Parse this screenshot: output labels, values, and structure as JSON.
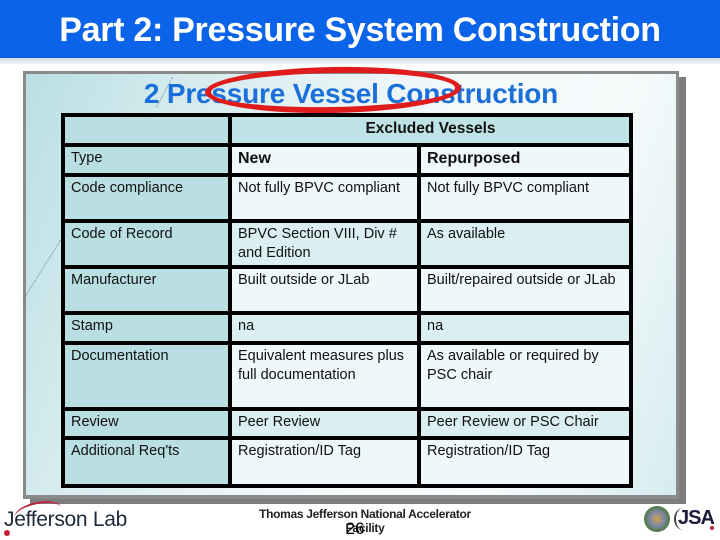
{
  "slide": {
    "title": "Part 2: Pressure System Construction",
    "heading": "2  Pressure Vessel Construction",
    "page_number": "26"
  },
  "table": {
    "group_header": "Excluded Vessels",
    "rows": [
      {
        "label": "Type",
        "new": "New",
        "repurposed": "Repurposed"
      },
      {
        "label": "Code compliance",
        "new": "Not fully BPVC compliant",
        "repurposed": "Not fully BPVC compliant"
      },
      {
        "label": "Code of Record",
        "new": "BPVC Section VIII, Div # and Edition",
        "repurposed": "As available"
      },
      {
        "label": "Manufacturer",
        "new": "Built outside or JLab",
        "repurposed": "Built/repaired outside or JLab"
      },
      {
        "label": "Stamp",
        "new": "na",
        "repurposed": "na"
      },
      {
        "label": "Documentation",
        "new": "Equivalent measures plus full documentation",
        "repurposed": "As available or required by PSC chair"
      },
      {
        "label": "Review",
        "new": "Peer Review",
        "repurposed": "Peer Review  or PSC Chair"
      },
      {
        "label": "Additional Req'ts",
        "new": "Registration/ID Tag",
        "repurposed": "Registration/ID Tag"
      }
    ]
  },
  "footer": {
    "logo_text": "Jefferson Lab",
    "facility": "Thomas Jefferson National Accelerator Facility",
    "right_logo_text": "JSA",
    "seal_icon": "doe-seal-icon"
  },
  "colors": {
    "title_bar": "#0a63e8",
    "heading": "#1a70d8",
    "highlight_ellipse": "#e01b1b",
    "label_cell": "#b9dfe2"
  }
}
